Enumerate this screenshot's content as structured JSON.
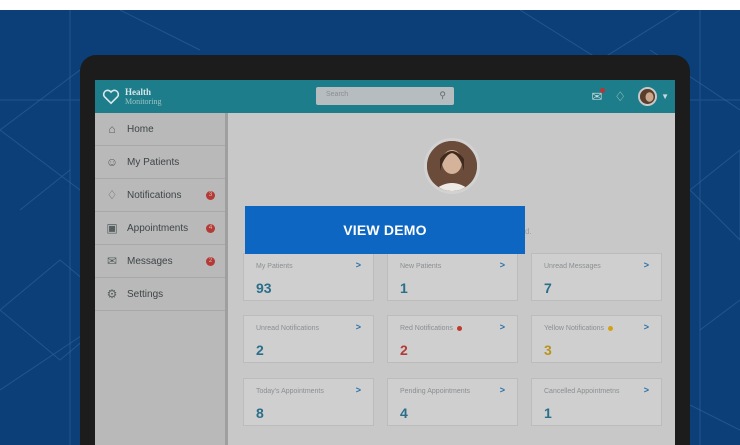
{
  "app": {
    "title": "Health",
    "subtitle": "Monitoring"
  },
  "search": {
    "placeholder": "Search"
  },
  "sidebar": {
    "items": [
      {
        "label": "Home",
        "icon": "home-icon"
      },
      {
        "label": "My Patients",
        "icon": "patients-icon"
      },
      {
        "label": "Notifications",
        "icon": "bell-icon",
        "badge": "3"
      },
      {
        "label": "Appointments",
        "icon": "calendar-icon",
        "badge": "4"
      },
      {
        "label": "Messages",
        "icon": "messages-icon",
        "badge": "2"
      },
      {
        "label": "Settings",
        "icon": "gear-icon"
      }
    ]
  },
  "greeting": {
    "text": "d."
  },
  "cards": [
    {
      "label": "My Patients",
      "value": "93",
      "valueColor": "#2a6f8a"
    },
    {
      "label": "New Patients",
      "value": "1",
      "valueColor": "#2a6f8a"
    },
    {
      "label": "Unread Messages",
      "value": "7",
      "valueColor": "#2a6f8a"
    },
    {
      "label": "Unread Notifications",
      "value": "2",
      "valueColor": "#2a6f8a"
    },
    {
      "label": "Red Notifications",
      "value": "2",
      "valueColor": "#b33a36",
      "dot": "#c0392b"
    },
    {
      "label": "Yellow Notifications",
      "value": "3",
      "valueColor": "#b8941f",
      "dot": "#d4a017"
    },
    {
      "label": "Today's Appointments",
      "value": "8",
      "valueColor": "#2a6f8a"
    },
    {
      "label": "Pending Appointments",
      "value": "4",
      "valueColor": "#2a6f8a"
    },
    {
      "label": "Cancelled Appointmetns",
      "value": "1",
      "valueColor": "#2a6f8a"
    }
  ],
  "cta": {
    "label": "VIEW DEMO"
  },
  "colors": {
    "accent": "#0d66c2",
    "topbar": "#1d7d8a",
    "background": "#0c3f78"
  }
}
